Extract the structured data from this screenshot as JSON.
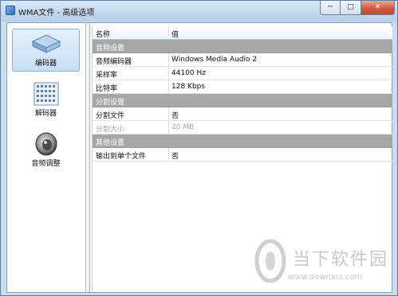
{
  "window": {
    "title": "WMA文件 - 高级选项",
    "minimize_glyph": "─",
    "maximize_glyph": "□",
    "close_glyph": "✕"
  },
  "sidebar": {
    "items": [
      {
        "label": "编码器",
        "icon": "encoder-icon",
        "selected": true
      },
      {
        "label": "解码器",
        "icon": "decoder-icon",
        "selected": false
      },
      {
        "label": "音频调整",
        "icon": "speaker-icon",
        "selected": false
      }
    ]
  },
  "grid": {
    "header": {
      "name": "名称",
      "value": "值"
    },
    "rows": [
      {
        "type": "section",
        "name": "音频设置"
      },
      {
        "type": "item",
        "name": "音频编码器",
        "value": "Windows Media Audio 2"
      },
      {
        "type": "item",
        "name": "采样率",
        "value": "44100 Hz"
      },
      {
        "type": "item",
        "name": "比特率",
        "value": "128 Kbps"
      },
      {
        "type": "section",
        "name": "分割设置"
      },
      {
        "type": "item",
        "name": "分割文件",
        "value": "否"
      },
      {
        "type": "item",
        "name": "分割大小",
        "value": "20 MB",
        "disabled": true
      },
      {
        "type": "section",
        "name": "其他设置"
      },
      {
        "type": "item",
        "name": "输出到单个文件",
        "value": "否"
      }
    ]
  },
  "watermark": {
    "brand": "当下软件园",
    "url": "www.downxia.com"
  }
}
